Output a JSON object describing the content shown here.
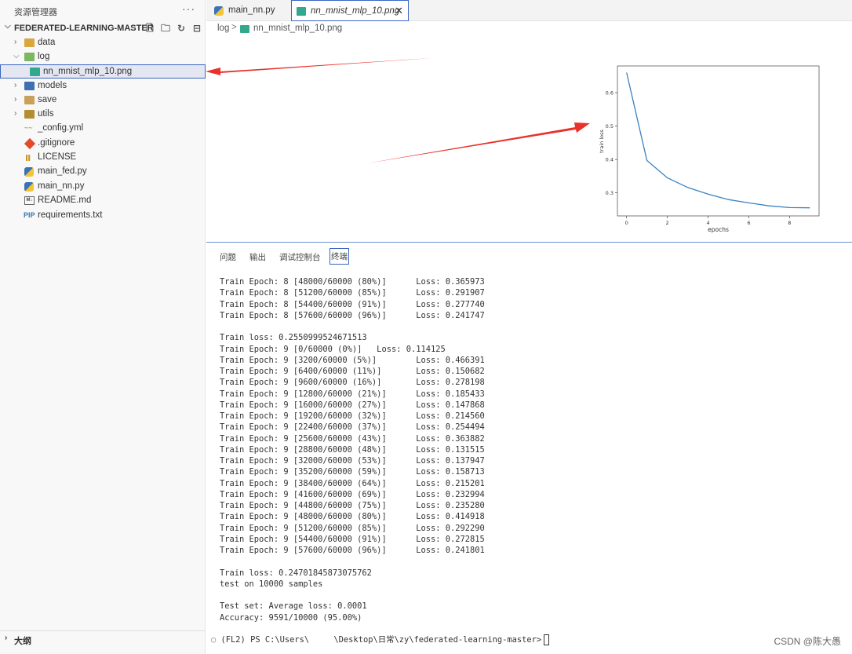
{
  "sidebar": {
    "title": "资源管理器",
    "more": "···",
    "project": "FEDERATED-LEARNING-MASTER",
    "items": [
      {
        "label": "data"
      },
      {
        "label": "log"
      },
      {
        "label": "nn_mnist_mlp_10.png"
      },
      {
        "label": "models"
      },
      {
        "label": "save"
      },
      {
        "label": "utils"
      },
      {
        "label": "_config.yml"
      },
      {
        "label": ".gitignore"
      },
      {
        "label": "LICENSE"
      },
      {
        "label": "main_fed.py"
      },
      {
        "label": "main_nn.py"
      },
      {
        "label": "README.md"
      },
      {
        "label": "requirements.txt"
      }
    ],
    "outline": "大纲",
    "icons": {
      "readme": "M↓",
      "req": "PIP",
      "yml": "~~",
      "license": "Ⅱ"
    }
  },
  "tabs": [
    {
      "label": "main_nn.py"
    },
    {
      "label": "nn_mnist_mlp_10.png"
    }
  ],
  "breadcrumb": {
    "folder": "log",
    "separator": ">",
    "file": "nn_mnist_mlp_10.png"
  },
  "panel": {
    "tabs": [
      "问题",
      "输出",
      "调试控制台",
      "终端"
    ],
    "terminal_lines": [
      "Train Epoch: 8 [48000/60000 (80%)]      Loss: 0.365973",
      "Train Epoch: 8 [51200/60000 (85%)]      Loss: 0.291907",
      "Train Epoch: 8 [54400/60000 (91%)]      Loss: 0.277740",
      "Train Epoch: 8 [57600/60000 (96%)]      Loss: 0.241747",
      "",
      "Train loss: 0.2550999524671513",
      "Train Epoch: 9 [0/60000 (0%)]   Loss: 0.114125",
      "Train Epoch: 9 [3200/60000 (5%)]        Loss: 0.466391",
      "Train Epoch: 9 [6400/60000 (11%)]       Loss: 0.150682",
      "Train Epoch: 9 [9600/60000 (16%)]       Loss: 0.278198",
      "Train Epoch: 9 [12800/60000 (21%)]      Loss: 0.185433",
      "Train Epoch: 9 [16000/60000 (27%)]      Loss: 0.147868",
      "Train Epoch: 9 [19200/60000 (32%)]      Loss: 0.214560",
      "Train Epoch: 9 [22400/60000 (37%)]      Loss: 0.254494",
      "Train Epoch: 9 [25600/60000 (43%)]      Loss: 0.363882",
      "Train Epoch: 9 [28800/60000 (48%)]      Loss: 0.131515",
      "Train Epoch: 9 [32000/60000 (53%)]      Loss: 0.137947",
      "Train Epoch: 9 [35200/60000 (59%)]      Loss: 0.158713",
      "Train Epoch: 9 [38400/60000 (64%)]      Loss: 0.215201",
      "Train Epoch: 9 [41600/60000 (69%)]      Loss: 0.232994",
      "Train Epoch: 9 [44800/60000 (75%)]      Loss: 0.235280",
      "Train Epoch: 9 [48000/60000 (80%)]      Loss: 0.414918",
      "Train Epoch: 9 [51200/60000 (85%)]      Loss: 0.292290",
      "Train Epoch: 9 [54400/60000 (91%)]      Loss: 0.272815",
      "Train Epoch: 9 [57600/60000 (96%)]      Loss: 0.241801",
      "",
      "Train loss: 0.24701845873075762",
      "test on 10000 samples",
      "",
      "Test set: Average loss: 0.0001",
      "Accuracy: 9591/10000 (95.00%)"
    ],
    "prompt_symbol": "○",
    "prompt": "(FL2) PS C:\\Users\\     \\Desktop\\日常\\zy\\federated-learning-master>",
    "watermark": "CSDN @陈大愚"
  },
  "chart_data": {
    "type": "line",
    "xlabel": "epochs",
    "ylabel": "train loss",
    "x": [
      0,
      1,
      2,
      3,
      4,
      5,
      6,
      7,
      8,
      9
    ],
    "y": [
      0.66,
      0.397,
      0.345,
      0.316,
      0.296,
      0.28,
      0.27,
      0.261,
      0.256,
      0.2551
    ],
    "xticks": [
      0,
      2,
      4,
      6,
      8
    ],
    "yticks": [
      0.3,
      0.4,
      0.5,
      0.6
    ],
    "xlim": [
      -0.45,
      9.45
    ],
    "ylim": [
      0.231,
      0.68
    ],
    "line_color": "#3a82c0",
    "grid": false
  },
  "colors": {
    "accent": "#3a66c2",
    "arrow": "#e8322a"
  }
}
